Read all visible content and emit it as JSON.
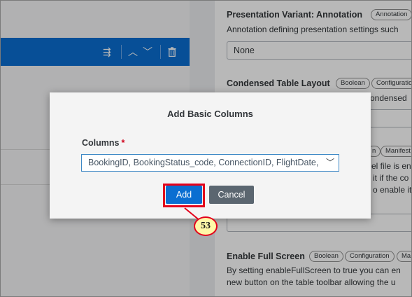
{
  "left_toolbar": {
    "icons": [
      "sort-icon",
      "move-up-icon",
      "move-down-icon",
      "delete-icon"
    ],
    "color": "#0a6ed1"
  },
  "right_panel": {
    "presentation_variant": {
      "title": "Presentation Variant: Annotation",
      "chip": "Annotation",
      "description": "Annotation defining presentation settings such",
      "select_value": "None"
    },
    "condensed_table": {
      "title": "Condensed Table Layout",
      "chips": [
        "Boolean",
        "Configuration"
      ],
      "description_fragment": "ondensed"
    },
    "hidden_property": {
      "chip_partial": "n",
      "chip_manifest": "Manifest",
      "fragments": [
        "el file is en",
        "it if the co",
        "o enable it"
      ]
    },
    "full_screen": {
      "title": "Enable Full Screen",
      "chips": [
        "Boolean",
        "Configuration",
        "Ma"
      ],
      "description": [
        "By setting enableFullScreen to true you can en",
        "new button on the table toolbar allowing the u"
      ]
    }
  },
  "dialog": {
    "title": "Add Basic Columns",
    "field_label": "Columns",
    "required_marker": "*",
    "columns_value": "BookingID, BookingStatus_code, ConnectionID, FlightDate,",
    "add_label": "Add",
    "cancel_label": "Cancel",
    "primary_color": "#0a6ed1"
  },
  "annotation": {
    "step_number": "53",
    "highlight_color": "#e3001b"
  }
}
